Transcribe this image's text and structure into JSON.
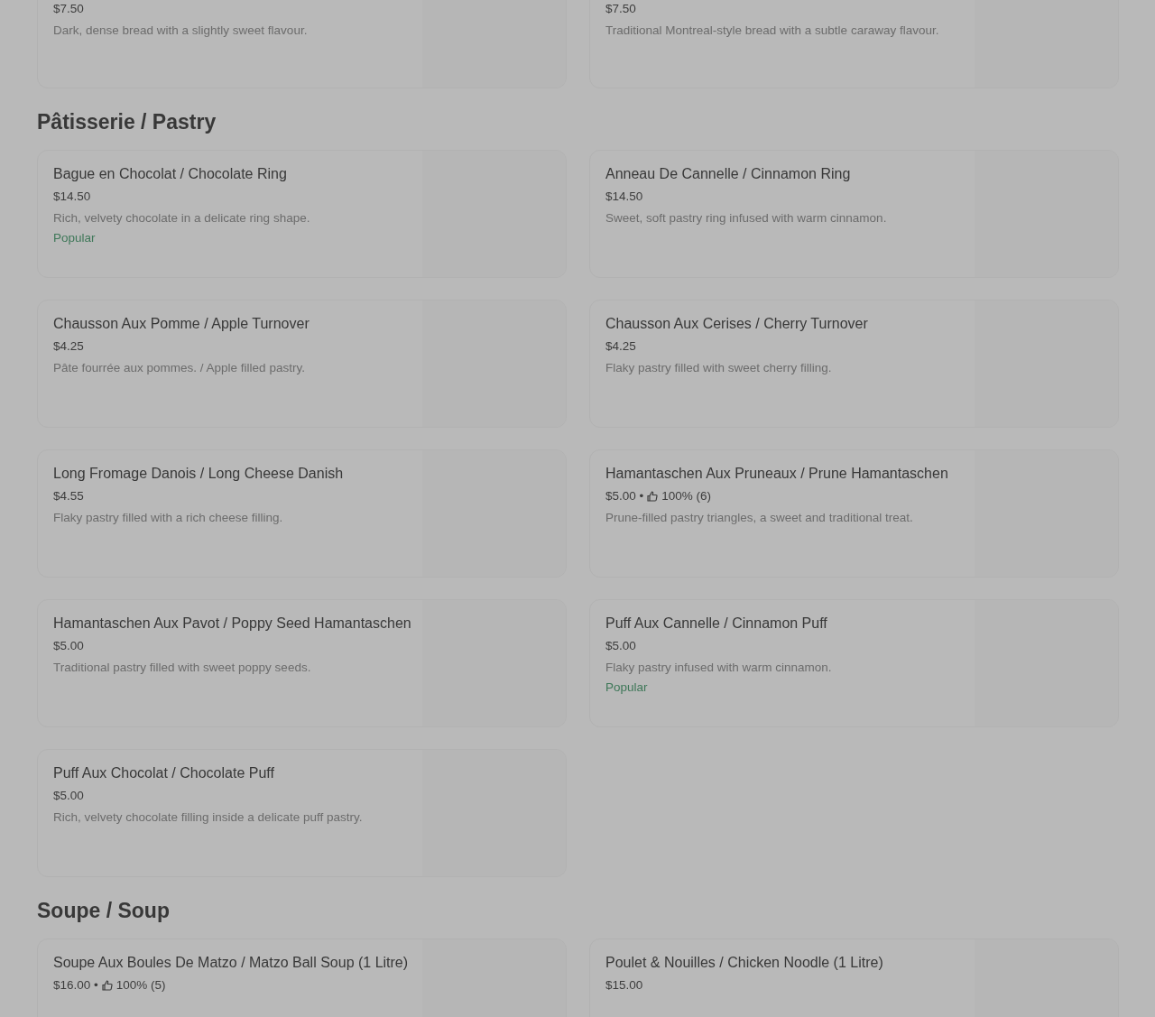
{
  "sections": [
    {
      "items": [
        {
          "price": "$7.50",
          "description": "Dark, dense bread with a slightly sweet flavour."
        },
        {
          "price": "$7.50",
          "description": "Traditional Montreal-style bread with a subtle caraway flavour."
        }
      ]
    },
    {
      "title": "Pâtisserie / Pastry",
      "items": [
        {
          "name": "Bague en Chocolat / Chocolate Ring",
          "price": "$14.50",
          "description": "Rich, velvety chocolate in a delicate ring shape.",
          "badge": "Popular"
        },
        {
          "name": "Anneau De Cannelle / Cinnamon Ring",
          "price": "$14.50",
          "description": "Sweet, soft pastry ring infused with warm cinnamon."
        },
        {
          "name": "Chausson Aux Pomme / Apple Turnover",
          "price": "$4.25",
          "description": "Pâte fourrée aux pommes. / Apple filled pastry."
        },
        {
          "name": "Chausson Aux Cerises / Cherry Turnover",
          "price": "$4.25",
          "description": "Flaky pastry filled with sweet cherry filling."
        },
        {
          "name": "Long Fromage Danois / Long Cheese Danish",
          "price": "$4.55",
          "description": "Flaky pastry filled with a rich cheese filling."
        },
        {
          "name": "Hamantaschen Aux Pruneaux / Prune Hamantaschen",
          "price": "$5.00 •",
          "rating": "100% (6)",
          "description": "Prune-filled pastry triangles, a sweet and traditional treat."
        },
        {
          "name": "Hamantaschen Aux Pavot / Poppy Seed Hamantaschen",
          "price": "$5.00",
          "description": "Traditional pastry filled with sweet poppy seeds."
        },
        {
          "name": "Puff Aux Cannelle / Cinnamon Puff",
          "price": "$5.00",
          "description": "Flaky pastry infused with warm cinnamon.",
          "badge": "Popular"
        },
        {
          "name": "Puff Aux Chocolat / Chocolate Puff",
          "price": "$5.00",
          "description": "Rich, velvety chocolate filling inside a delicate puff pastry."
        }
      ]
    },
    {
      "title": "Soupe / Soup",
      "items": [
        {
          "name": "Soupe Aux Boules De Matzo / Matzo Ball Soup (1 Litre)",
          "price": "$16.00 •",
          "rating": "100% (5)"
        },
        {
          "name": "Poulet & Nouilles / Chicken Noodle (1 Litre)",
          "price": "$15.00"
        }
      ]
    }
  ]
}
